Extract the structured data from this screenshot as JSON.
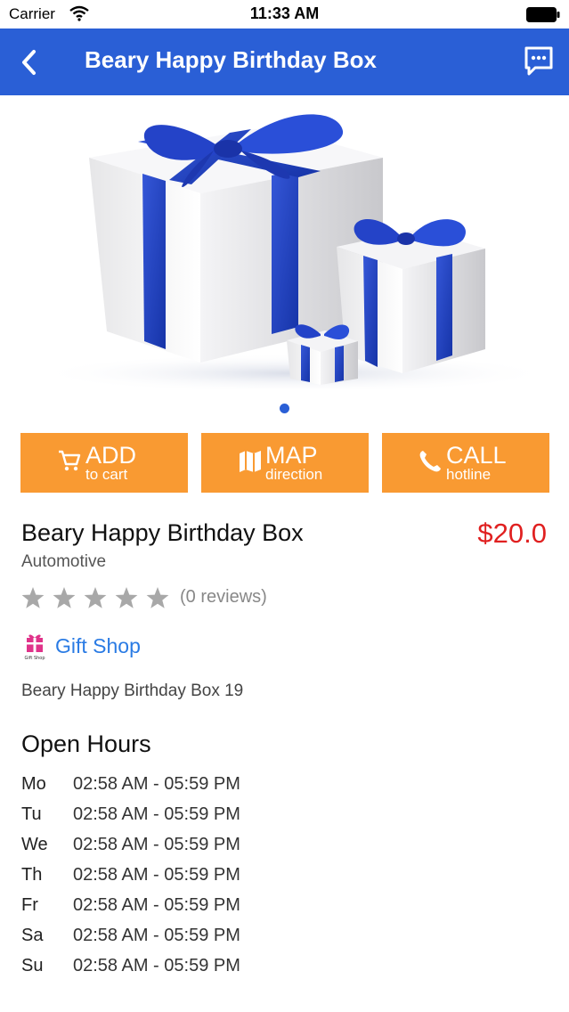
{
  "status_bar": {
    "carrier": "Carrier",
    "time": "11:33 AM"
  },
  "nav": {
    "title": "Beary Happy Birthday Box",
    "bar_color": "#2a5fd6",
    "back_icon": "chevron-left-icon",
    "right_icon": "chat-bubble-icon"
  },
  "gallery": {
    "page_count": 1,
    "active_page": 1
  },
  "actions": [
    {
      "icon": "cart-icon",
      "label": "ADD",
      "sub": "to cart"
    },
    {
      "icon": "map-icon",
      "label": "MAP",
      "sub": "direction"
    },
    {
      "icon": "phone-icon",
      "label": "CALL",
      "sub": "hotline"
    }
  ],
  "accent_color": "#f99a32",
  "product": {
    "name": "Beary Happy Birthday Box",
    "price": "$20.0",
    "category": "Automotive",
    "rating": 0,
    "rating_max": 5,
    "reviews": "(0 reviews)",
    "description": "Beary Happy Birthday Box 19"
  },
  "shop": {
    "name": "Gift Shop",
    "logo_caption": "Gift Shop"
  },
  "open_hours": {
    "heading": "Open Hours",
    "rows": [
      {
        "day": "Mo",
        "time": "02:58 AM - 05:59 PM"
      },
      {
        "day": "Tu",
        "time": "02:58 AM - 05:59 PM"
      },
      {
        "day": "We",
        "time": "02:58 AM - 05:59 PM"
      },
      {
        "day": "Th",
        "time": "02:58 AM - 05:59 PM"
      },
      {
        "day": "Fr",
        "time": "02:58 AM - 05:59 PM"
      },
      {
        "day": "Sa",
        "time": "02:58 AM - 05:59 PM"
      },
      {
        "day": "Su",
        "time": "02:58 AM - 05:59 PM"
      }
    ]
  }
}
